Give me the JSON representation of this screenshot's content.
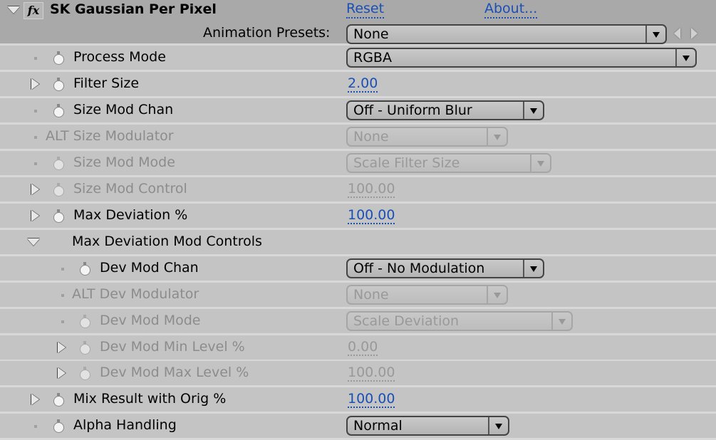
{
  "effect": {
    "name": "SK Gaussian Per Pixel",
    "fx_icon": "fx",
    "reset_label": "Reset",
    "about_label": "About...",
    "presets_label": "Animation Presets:",
    "presets_value": "None"
  },
  "params": [
    {
      "label": "Process Mode",
      "type": "dropdown",
      "value": "RGBA",
      "enabled": true
    },
    {
      "label": "Filter Size",
      "type": "number",
      "value": "2.00",
      "enabled": true
    },
    {
      "label": "Size Mod Chan",
      "type": "dropdown",
      "value": "Off - Uniform Blur",
      "enabled": true
    },
    {
      "label": "ALT Size Modulator",
      "type": "dropdown",
      "value": "None",
      "enabled": false
    },
    {
      "label": "Size Mod Mode",
      "type": "dropdown",
      "value": "Scale Filter Size",
      "enabled": false
    },
    {
      "label": "Size Mod Control",
      "type": "number",
      "value": "100.00",
      "enabled": false
    },
    {
      "label": "Max Deviation %",
      "type": "number",
      "value": "100.00",
      "enabled": true
    },
    {
      "label": "Max Deviation Mod Controls",
      "type": "group",
      "expanded": true
    },
    {
      "label": "Dev Mod Chan",
      "type": "dropdown",
      "value": "Off - No Modulation",
      "enabled": true
    },
    {
      "label": "ALT Dev Modulator",
      "type": "dropdown",
      "value": "None",
      "enabled": false
    },
    {
      "label": "Dev Mod Mode",
      "type": "dropdown",
      "value": "Scale Deviation",
      "enabled": false
    },
    {
      "label": "Dev Mod Min Level %",
      "type": "number",
      "value": "0.00",
      "enabled": false
    },
    {
      "label": "Dev Mod Max Level %",
      "type": "number",
      "value": "100.00",
      "enabled": false
    },
    {
      "label": "Mix Result with Orig %",
      "type": "number",
      "value": "100.00",
      "enabled": true
    },
    {
      "label": "Alpha Handling",
      "type": "dropdown",
      "value": "Normal",
      "enabled": true
    }
  ],
  "colors": {
    "link": "#1a4fb5",
    "header_bg": "#a9a9a9",
    "row_bg": "#c4c4c4",
    "disabled_text": "#8c8c8c"
  }
}
